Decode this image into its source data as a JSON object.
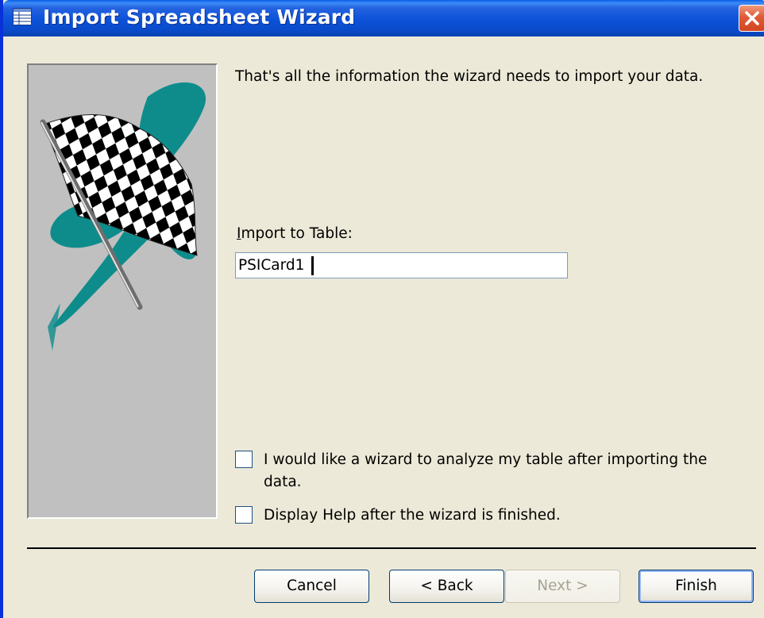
{
  "window": {
    "title": "Import Spreadsheet Wizard"
  },
  "content": {
    "info_text": "That's all the information the wizard needs to import your data.",
    "import_label": "Import to Table:",
    "table_name_value": "PSICard1"
  },
  "options": {
    "analyze": {
      "checked": false,
      "line1": "I would like a wizard to analyze my table after importing the",
      "line2": "data."
    },
    "help": {
      "checked": false,
      "label": "Display Help after the wizard is finished."
    }
  },
  "buttons": {
    "cancel": "Cancel",
    "back": "< Back",
    "next": "Next >",
    "finish": "Finish"
  },
  "colors": {
    "titlebar": "#0A4AC8",
    "dialog_background": "#ECE9D8",
    "image_panel": "#C0C0C0",
    "flag_swoosh": "#0E8C8C",
    "close_button": "#D04820"
  },
  "icons": {
    "title": "datasheet-icon",
    "close": "close-x-icon",
    "illustration": "checkered-flag-illustration"
  }
}
